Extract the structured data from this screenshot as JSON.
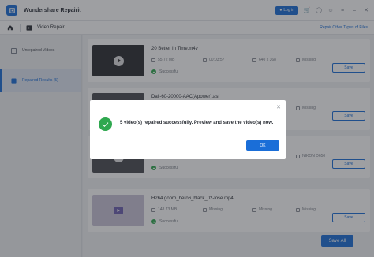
{
  "app": {
    "title": "Wondershare Repairit",
    "login_label": "Log in"
  },
  "nav": {
    "title": "Video Repair",
    "repair_other": "Repair Other Types of Files"
  },
  "sidebar": {
    "items": [
      {
        "label": "Unrepaired Videos"
      },
      {
        "label": "Repaired Results (5)"
      }
    ]
  },
  "files": [
    {
      "name": "20 Better In Time.m4v",
      "size": "55.72 MB",
      "duration": "00:03:57",
      "resolution": "640 x 368",
      "camera": "Missing",
      "status": "Successful",
      "save_label": "Save"
    },
    {
      "name": "Dali-60-20000-AAC(Apower).asf",
      "size": "",
      "duration": "",
      "resolution": "",
      "camera": "Missing",
      "status": "",
      "save_label": "Save"
    },
    {
      "name": "",
      "size": "",
      "duration": "",
      "resolution": "",
      "camera": "NIKON D650",
      "status": "Successful",
      "save_label": "Save"
    },
    {
      "name": "H264 gopro_hero6_black_02-lose.mp4",
      "size": "148.73 MB",
      "duration": "Missing",
      "resolution": "Missing",
      "camera": "Missing",
      "status": "Successful",
      "save_label": "Save"
    }
  ],
  "save_all_label": "Save All",
  "dialog": {
    "message": "5 video(s) repaired successfully. Preview and save the video(s) now.",
    "ok_label": "OK"
  }
}
